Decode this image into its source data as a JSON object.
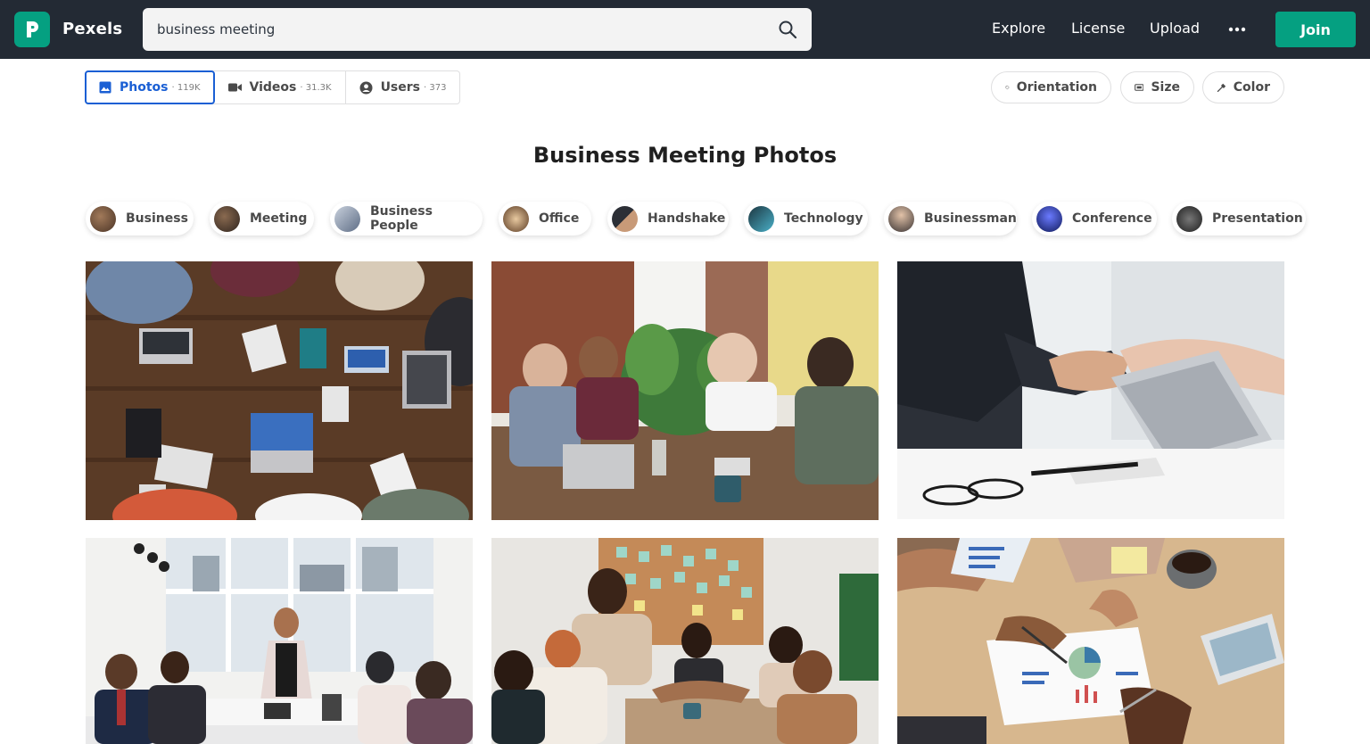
{
  "header": {
    "brand": "Pexels",
    "search_value": "business meeting",
    "nav": {
      "explore": "Explore",
      "license": "License",
      "upload": "Upload"
    },
    "join_label": "Join",
    "brand_color": "#05a081"
  },
  "tabs": [
    {
      "label": "Photos",
      "count": "· 119K",
      "icon": "image-icon"
    },
    {
      "label": "Videos",
      "count": "· 31.3K",
      "icon": "video-icon"
    },
    {
      "label": "Users",
      "count": "· 373",
      "icon": "user-icon"
    }
  ],
  "filters": {
    "orientation": "Orientation",
    "size": "Size",
    "color": "Color"
  },
  "page_title": "Business Meeting Photos",
  "related": [
    {
      "label": "Business",
      "thumb_color": "#6b5040"
    },
    {
      "label": "Meeting",
      "thumb_color": "#4e3b30"
    },
    {
      "label": "Business People",
      "thumb_color": "#8d98ab"
    },
    {
      "label": "Office",
      "thumb_color": "#6a4a32"
    },
    {
      "label": "Handshake",
      "thumb_color": "#3b3f48"
    },
    {
      "label": "Technology",
      "thumb_color": "#2a5a6c"
    },
    {
      "label": "Businessman",
      "thumb_color": "#7a6a62"
    },
    {
      "label": "Conference",
      "thumb_color": "#2b3a8a"
    },
    {
      "label": "Presentation",
      "thumb_color": "#3a3a3a"
    }
  ],
  "photos": [
    {
      "alt": "team around wooden table with laptops, top view"
    },
    {
      "alt": "meeting in bright office with plants"
    },
    {
      "alt": "business handshake over laptop"
    },
    {
      "alt": "woman presenting in conference room"
    },
    {
      "alt": "team shaking hands at office table"
    },
    {
      "alt": "hands reviewing charts with coffee"
    }
  ]
}
